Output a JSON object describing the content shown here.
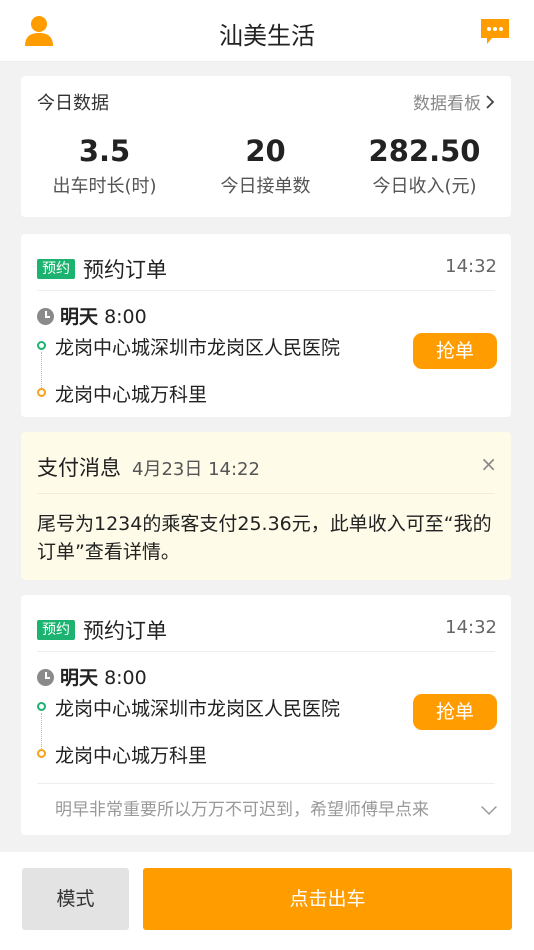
{
  "header": {
    "title": "汕美生活",
    "left_icon": "user-icon",
    "right_icon": "message-icon",
    "accent_color": "#ff9d00"
  },
  "today": {
    "title": "今日数据",
    "board_link": "数据看板",
    "stats": [
      {
        "value": "3.5",
        "label": "出车时长(时)"
      },
      {
        "value": "20",
        "label": "今日接单数"
      },
      {
        "value": "282.50",
        "label": "今日收入(元)"
      }
    ]
  },
  "orders": [
    {
      "badge": "预约",
      "title": "预约订单",
      "time": "14:32",
      "when_day": "明天",
      "when_time": "8:00",
      "from": "龙岗中心城深圳市龙岗区人民医院",
      "to": "龙岗中心城万科里",
      "grab_label": "抢单"
    },
    {
      "badge": "预约",
      "title": "预约订单",
      "time": "14:32",
      "when_day": "明天",
      "when_time": "8:00",
      "from": "龙岗中心城深圳市龙岗区人民医院",
      "to": "龙岗中心城万科里",
      "grab_label": "抢单",
      "note": "明早非常重要所以万万不可迟到，希望师傅早点来"
    }
  ],
  "payment": {
    "title": "支付消息",
    "date": "4月23日  14:22",
    "close_label": "×",
    "text": "尾号为1234的乘客支付25.36元，此单收入可至“我的订单”查看详情。"
  },
  "bottom": {
    "mode_label": "模式",
    "go_label": "点击出车"
  },
  "colors": {
    "badge_green": "#1bb36f",
    "button_orange": "#ff9d00",
    "payment_bg": "#fefbe8"
  }
}
